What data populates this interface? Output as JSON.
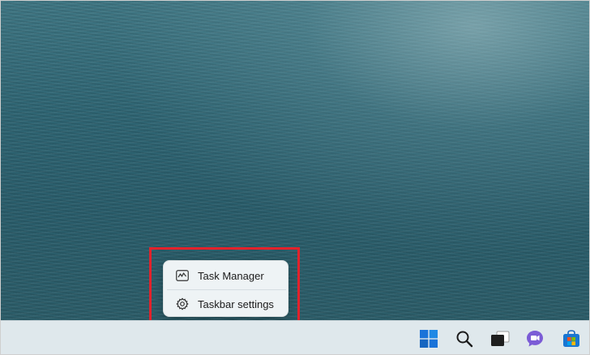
{
  "context_menu": {
    "items": [
      {
        "label": "Task Manager",
        "icon": "task-manager-icon"
      },
      {
        "label": "Taskbar settings",
        "icon": "gear-icon"
      }
    ]
  },
  "taskbar": {
    "icons": [
      "windows-start-icon",
      "search-icon",
      "task-view-icon",
      "chat-icon",
      "store-icon"
    ]
  },
  "colors": {
    "highlight": "#e3222b",
    "wallpaper": "#2f6573",
    "taskbar": "#dfe8ec",
    "start_blue": "#1a73d9"
  }
}
